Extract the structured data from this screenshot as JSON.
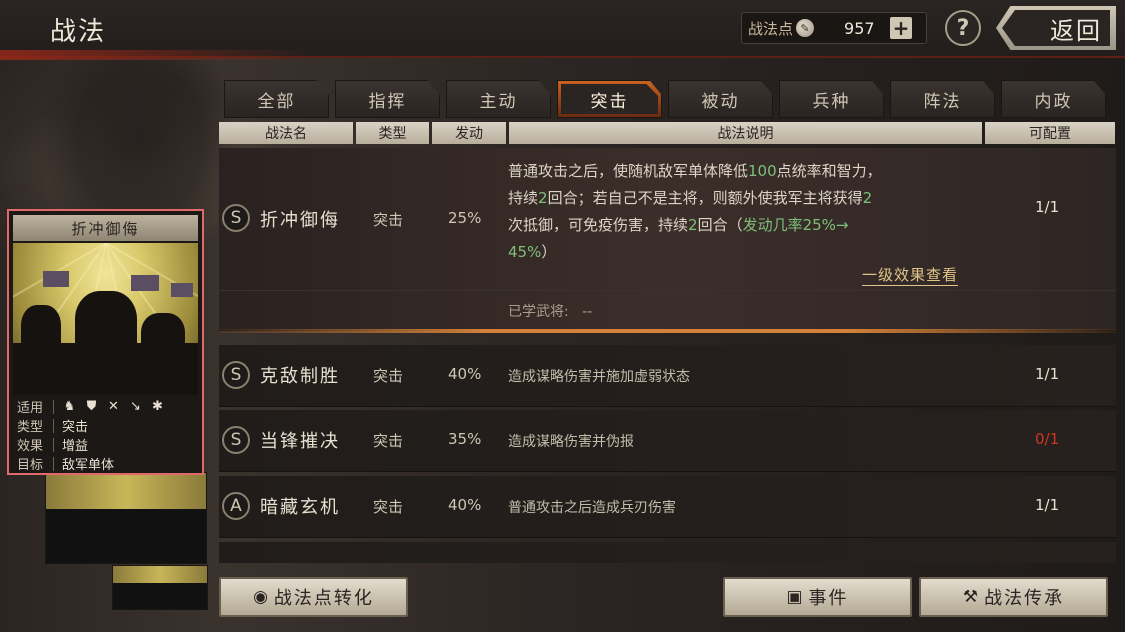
{
  "header": {
    "title": "战法",
    "points_label": "战法点",
    "points_value": "957",
    "plus_label": "+",
    "help_label": "?",
    "back_label": "返回"
  },
  "tabs": [
    {
      "label": "全部",
      "active": false
    },
    {
      "label": "指挥",
      "active": false
    },
    {
      "label": "主动",
      "active": false
    },
    {
      "label": "突击",
      "active": true
    },
    {
      "label": "被动",
      "active": false
    },
    {
      "label": "兵种",
      "active": false
    },
    {
      "label": "阵法",
      "active": false
    },
    {
      "label": "内政",
      "active": false
    }
  ],
  "columns": {
    "name": "战法名",
    "type": "类型",
    "rate": "发动",
    "desc": "战法说明",
    "slots": "可配置"
  },
  "selected_skill": {
    "grade": "S",
    "name": "折冲御侮",
    "type": "突击",
    "rate": "25%",
    "desc_line1_a": "普通攻击之后，使随机敌军单体降低",
    "desc_line1_num": "100",
    "desc_line1_b": "点统率和智力，",
    "desc_line2_a": "持续",
    "desc_line2_num": "2",
    "desc_line2_b": "回合；若自己不是主将，则额外使我军主将获得",
    "desc_line2_num2": "2",
    "desc_line3_a": "次抵御，可免疫伤害，持续",
    "desc_line3_num": "2",
    "desc_line3_b": "回合（",
    "desc_line3_hl": "发动几率25%→",
    "desc_line4_hl": "45%",
    "desc_line4_b": "）",
    "slots": "1/1",
    "effect_link": "一级效果查看",
    "learned_label": "已学武将:",
    "learned_value": "--"
  },
  "skills": [
    {
      "grade": "S",
      "name": "克敌制胜",
      "type": "突击",
      "rate": "40%",
      "desc": "造成谋略伤害并施加虚弱状态",
      "slots": "1/1",
      "slots_red": false
    },
    {
      "grade": "S",
      "name": "当锋摧决",
      "type": "突击",
      "rate": "35%",
      "desc": "造成谋略伤害并伪报",
      "slots": "0/1",
      "slots_red": true
    },
    {
      "grade": "A",
      "name": "暗藏玄机",
      "type": "突击",
      "rate": "40%",
      "desc": "普通攻击之后造成兵刃伤害",
      "slots": "1/1",
      "slots_red": false
    }
  ],
  "card": {
    "title": "折冲御侮",
    "rows": {
      "use_key": "适用",
      "type_key": "类型",
      "type_val": "突击",
      "effect_key": "效果",
      "effect_val": "增益",
      "target_key": "目标",
      "target_val": "敌军单体"
    },
    "unit_icons": [
      "cavalry-icon",
      "shield-icon",
      "bow-icon",
      "spear-icon",
      "siege-icon"
    ]
  },
  "buttons": {
    "convert": "战法点转化",
    "event": "事件",
    "inherit": "战法传承"
  },
  "colors": {
    "accent_orange": "#c9621f",
    "highlight_green": "#7fbf7a",
    "warning_red": "#d0351f",
    "card_border": "#e06a6a"
  }
}
